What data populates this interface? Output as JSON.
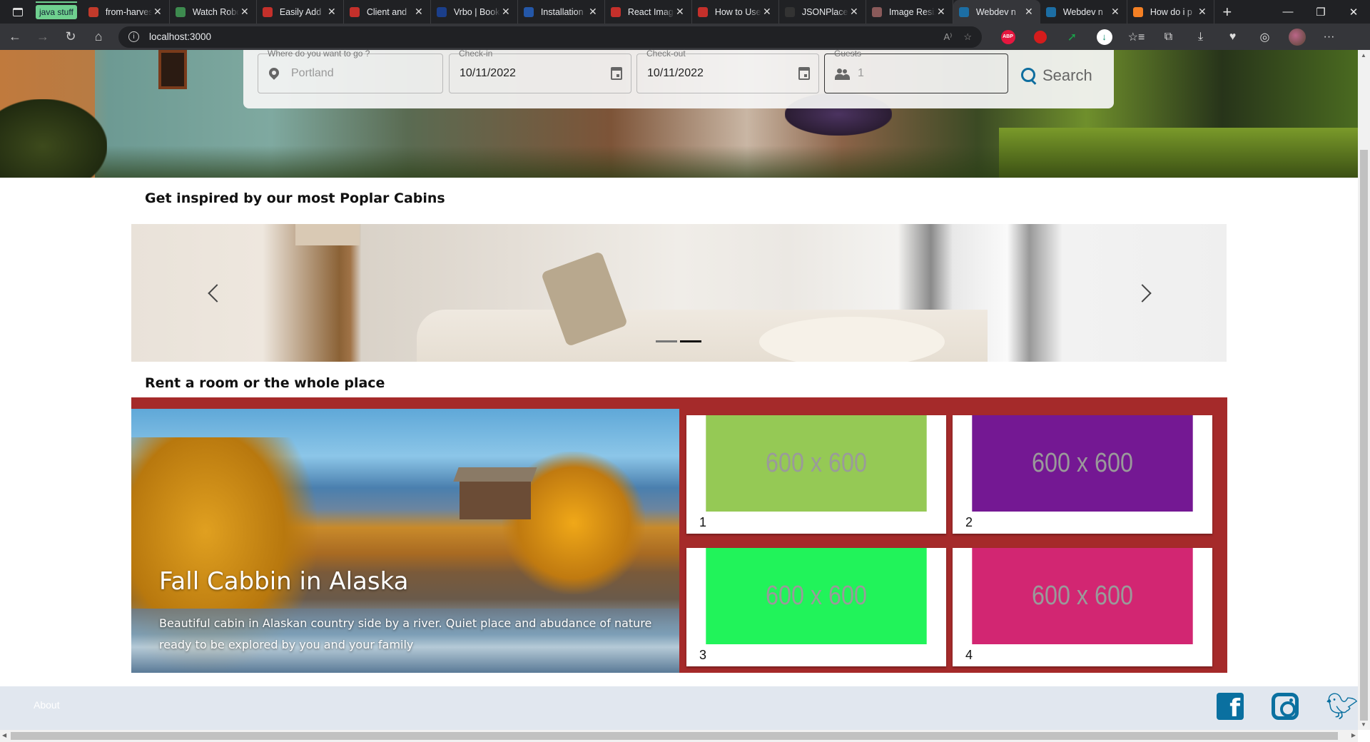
{
  "browser": {
    "tab_group_label": "java stuff",
    "tabs": [
      {
        "title": "from-harvest",
        "favicon": "pdf-icon",
        "color": "#c23a2b"
      },
      {
        "title": "Watch Robots",
        "favicon": "play-circle-icon",
        "color": "#3d8b4f"
      },
      {
        "title": "Easily Add",
        "favicon": "youtube-icon",
        "color": "#c4302b"
      },
      {
        "title": "Client and",
        "favicon": "youtube-icon",
        "color": "#c4302b"
      },
      {
        "title": "Vrbo | Book",
        "favicon": "vrbo-icon",
        "color": "#1b3f8b"
      },
      {
        "title": "Installation",
        "favicon": "mui-icon",
        "color": "#2457a8"
      },
      {
        "title": "React Image",
        "favicon": "youtube-icon",
        "color": "#c4302b"
      },
      {
        "title": "How to Use",
        "favicon": "youtube-icon",
        "color": "#c4302b"
      },
      {
        "title": "JSONPlaceholder",
        "favicon": "json-icon",
        "color": "#333333"
      },
      {
        "title": "Image Resizer",
        "favicon": "image-resizer-icon",
        "color": "#8a5a5a"
      },
      {
        "title": "Webdev n",
        "favicon": "webdev-icon",
        "color": "#1c6ea4",
        "active": true
      },
      {
        "title": "Webdev n",
        "favicon": "house-icon",
        "color": "#1c6ea4"
      },
      {
        "title": "How do i p",
        "favicon": "stackoverflow-icon",
        "color": "#f48024"
      }
    ],
    "new_tab_label": "+",
    "url": "localhost:3000",
    "window_controls": {
      "minimize": "—",
      "restore": "❐",
      "close": "✕"
    }
  },
  "search": {
    "destination": {
      "label": "Where do you want to go ?",
      "placeholder": "Portland"
    },
    "checkin": {
      "label": "Check-in",
      "value": "10/11/2022"
    },
    "checkout": {
      "label": "Check-out",
      "value": "10/11/2022"
    },
    "guests": {
      "label": "Guests",
      "placeholder": "1"
    },
    "button_label": "Search"
  },
  "sections": {
    "popular_heading": "Get inspired by our most Poplar Cabins",
    "rent_heading": "Rent a room or the whole place"
  },
  "carousel": {
    "slide_count": 2,
    "active_index": 1,
    "prev_label": "‹",
    "next_label": "›"
  },
  "feature": {
    "title": "Fall Cabbin in Alaska",
    "description": "Beautiful cabin in Alaskan country side by a river. Quiet place and abudance of nature ready to be explored by you and your family"
  },
  "cards": [
    {
      "placeholder": "600 x 600",
      "label": "1",
      "color": "#95c955"
    },
    {
      "placeholder": "600 x 600",
      "label": "2",
      "color": "#741893"
    },
    {
      "placeholder": "600 x 600",
      "label": "3",
      "color": "#21f35a"
    },
    {
      "placeholder": "600 x 600",
      "label": "4",
      "color": "#d22672"
    }
  ],
  "colors": {
    "grid_background": "#a52a2a",
    "accent": "#0a70a0",
    "footer_background": "#e1e7ef"
  },
  "footer": {
    "about_label": "About",
    "social": [
      "facebook-icon",
      "instagram-icon",
      "twitter-icon"
    ]
  }
}
